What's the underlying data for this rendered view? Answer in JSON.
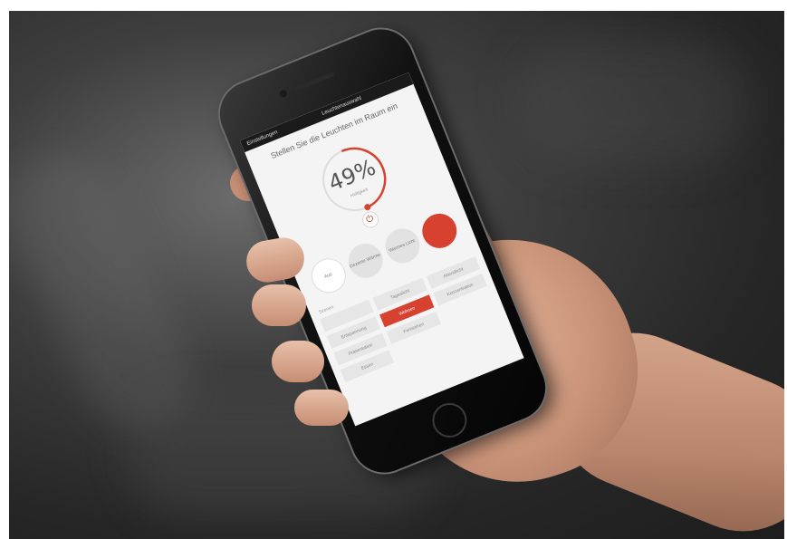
{
  "phone_screen": {
    "status_left": "Einstellungen",
    "status_center": "Leuchtenauswahl",
    "heading": "Stellen Sie die Leuchten im Raum ein",
    "dial": {
      "value": "49%",
      "sublabel": "Helligkeit",
      "fraction": 0.49,
      "accent_color": "#d7412f"
    },
    "power_icon": "power-icon",
    "mode_circles": [
      {
        "label": "Aus",
        "style": "white"
      },
      {
        "label": "Dezente Wärme",
        "style": "gray"
      },
      {
        "label": "Warmes Licht",
        "style": "gray"
      },
      {
        "label": "",
        "style": "red"
      }
    ],
    "scene_label": "Szenen",
    "scene_buttons": [
      {
        "label": "",
        "selected": false
      },
      {
        "label": "Tageslicht",
        "selected": false
      },
      {
        "label": "Abendlicht",
        "selected": false
      },
      {
        "label": "Entspannung",
        "selected": false
      },
      {
        "label": "Wohnen",
        "selected": true
      },
      {
        "label": "Konzentration",
        "selected": false
      },
      {
        "label": "Präsentation",
        "selected": false
      },
      {
        "label": "Fernsehen",
        "selected": false
      },
      {
        "label": "",
        "selected": false
      },
      {
        "label": "Essen",
        "selected": false
      }
    ]
  }
}
